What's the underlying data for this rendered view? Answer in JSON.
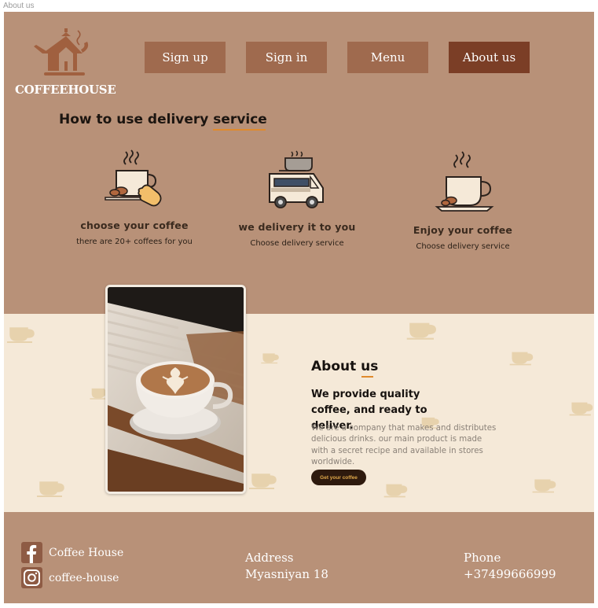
{
  "window": {
    "title": "About us"
  },
  "brand": {
    "name": "COFFEEHOUSE",
    "logo_icon": "teapot-house-icon"
  },
  "nav": {
    "items": [
      {
        "label": "Sign up",
        "active": false
      },
      {
        "label": "Sign in",
        "active": false
      },
      {
        "label": "Menu",
        "active": false
      },
      {
        "label": "About us",
        "active": true
      }
    ]
  },
  "delivery": {
    "title_main": "How to use delivery ",
    "title_accent": "service",
    "steps": [
      {
        "icon": "hand-coffee-cup-icon",
        "title": "choose your coffee",
        "subtitle": "there are 20+ coffees for you"
      },
      {
        "icon": "coffee-truck-icon",
        "title": "we delivery it to you",
        "subtitle": "Choose delivery service"
      },
      {
        "icon": "coffee-cup-saucer-icon",
        "title": "Enjoy your coffee",
        "subtitle": "Choose delivery service"
      }
    ]
  },
  "about": {
    "title_main": "About ",
    "title_accent": "us",
    "headline": "We provide quality coffee, and ready to deliver.",
    "body": "We are a company that makes and distributes delicious drinks. our main product is made with a secret recipe and available in stores worldwide.",
    "cta_label": "Get your coffee",
    "photo": "latte-art-cup-photo"
  },
  "footer": {
    "social": [
      {
        "icon": "facebook-icon",
        "label": "Coffee House"
      },
      {
        "icon": "instagram-icon",
        "label": "coffee-house"
      }
    ],
    "address_label": "Address",
    "address_value": "Myasniyan 18",
    "phone_label": "Phone",
    "phone_value": "+37499666999"
  },
  "colors": {
    "hero_bg": "#b89178",
    "nav_button": "#9f6a4e",
    "nav_active": "#7b3e26",
    "about_bg": "#f5e9d8",
    "accent_underline": "#e08a2c",
    "cta_bg": "#2e1a0e"
  }
}
